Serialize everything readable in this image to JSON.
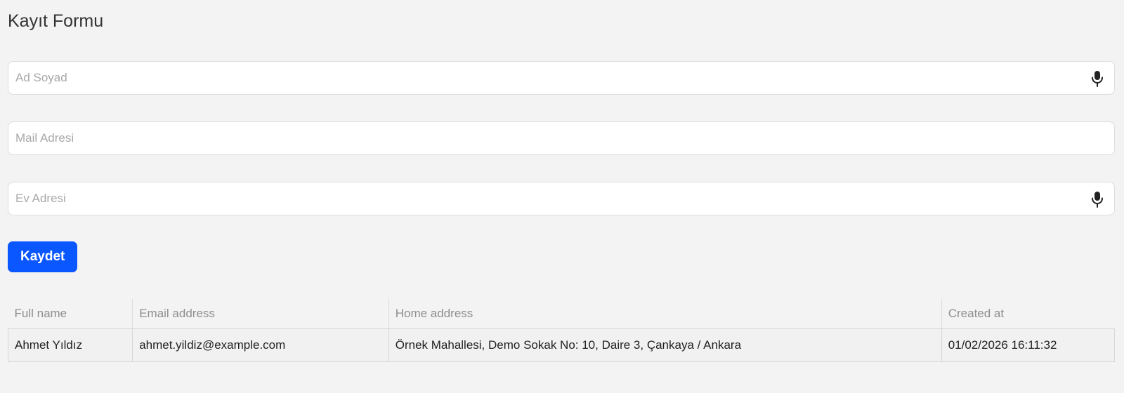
{
  "form": {
    "title": "Kayıt Formu",
    "fields": [
      {
        "placeholder": "Ad Soyad",
        "value": "",
        "has_mic": true
      },
      {
        "placeholder": "Mail Adresi",
        "value": "",
        "has_mic": false
      },
      {
        "placeholder": "Ev Adresi",
        "value": "",
        "has_mic": true
      }
    ],
    "save_label": "Kaydet"
  },
  "icons": {
    "mic": "microphone-icon"
  },
  "colors": {
    "background": "#f3f3f3",
    "primary_button": "#0b57ff",
    "placeholder_text": "#a8a8a8",
    "header_text": "#8e8e8e"
  },
  "table": {
    "columns": [
      "Full name",
      "Email address",
      "Home address",
      "Created at"
    ],
    "rows": [
      {
        "full_name": "Ahmet Yıldız",
        "email": "ahmet.yildiz@example.com",
        "home_address": "Örnek Mahallesi, Demo Sokak No: 10, Daire 3, Çankaya / Ankara",
        "created_at": "01/02/2026 16:11:32"
      }
    ]
  }
}
